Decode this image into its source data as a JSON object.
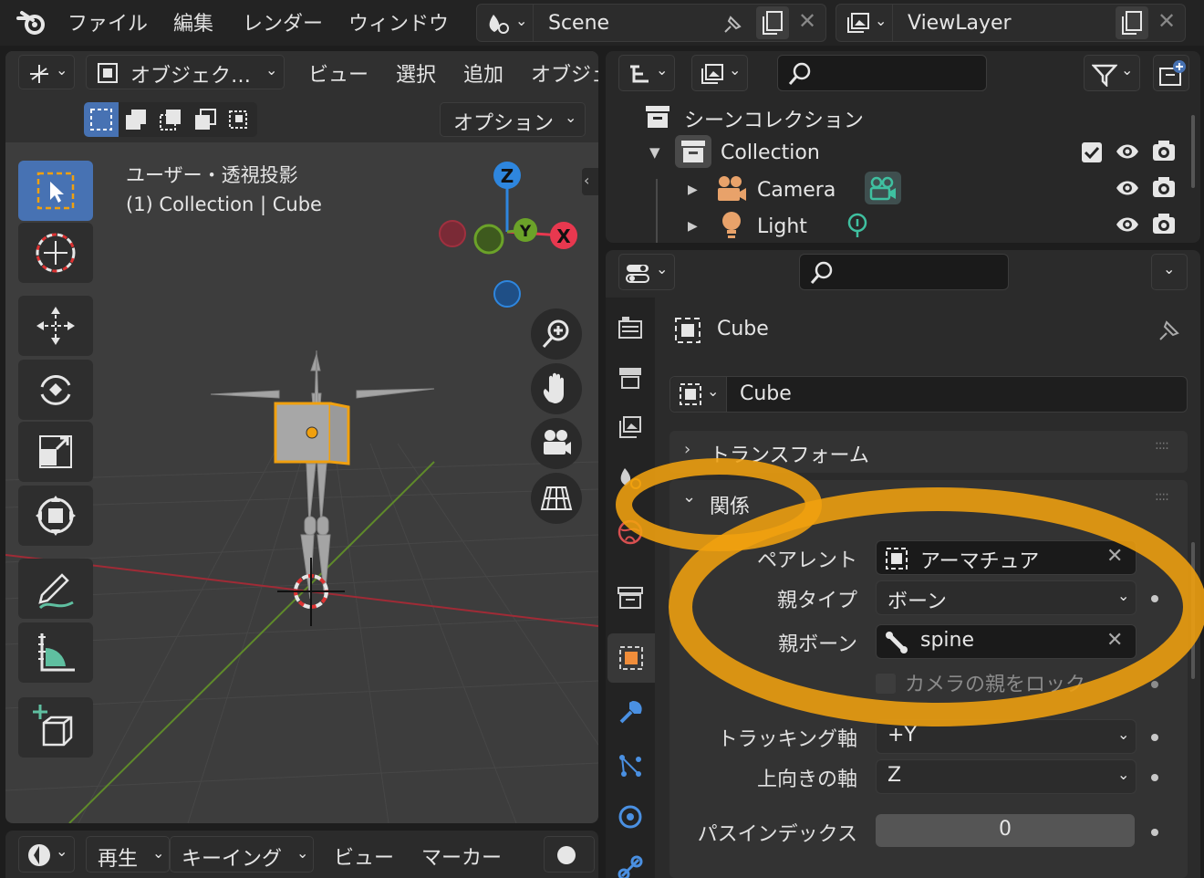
{
  "topbar": {
    "menus": [
      "ファイル",
      "編集",
      "レンダー",
      "ウィンドウ"
    ],
    "scene": "Scene",
    "view_layer": "ViewLayer"
  },
  "viewport": {
    "mode": "オブジェク…",
    "menus": [
      "ビュー",
      "選択",
      "追加",
      "オブジェ"
    ],
    "options": "オプション",
    "view_name": "ユーザー・透視投影",
    "collection_label": "(1) Collection | Cube",
    "axes": {
      "z": "Z",
      "y": "Y",
      "x": "X"
    }
  },
  "outliner": {
    "scene_collection": "シーンコレクション",
    "collection": "Collection",
    "items": [
      {
        "label": "Camera",
        "icon": "camera-object-icon"
      },
      {
        "label": "Light",
        "icon": "light-object-icon"
      }
    ]
  },
  "properties": {
    "object_name": "Cube",
    "data_name": "Cube",
    "panels": {
      "transform": "トランスフォーム",
      "relations": "関係"
    },
    "relations": {
      "parent_label": "ペアレント",
      "parent_value": "アーマチュア",
      "parent_type_label": "親タイプ",
      "parent_type_value": "ボーン",
      "parent_bone_label": "親ボーン",
      "parent_bone_value": "spine",
      "lock_camera_parent": "カメラの親をロック",
      "tracking_axis_label": "トラッキング軸",
      "tracking_axis_value": "+Y",
      "up_axis_label": "上向きの軸",
      "up_axis_value": "Z",
      "pass_index_label": "パスインデックス",
      "pass_index_value": "0"
    }
  },
  "timeline": {
    "playback": "再生",
    "keying": "キーイング",
    "view": "ビュー",
    "marker": "マーカー"
  },
  "colors": {
    "highlight": "#f0a00f",
    "accent_blue": "#4772b3",
    "axis_x": "#e8384f",
    "axis_y": "#6ba229",
    "axis_z": "#2e86de"
  }
}
